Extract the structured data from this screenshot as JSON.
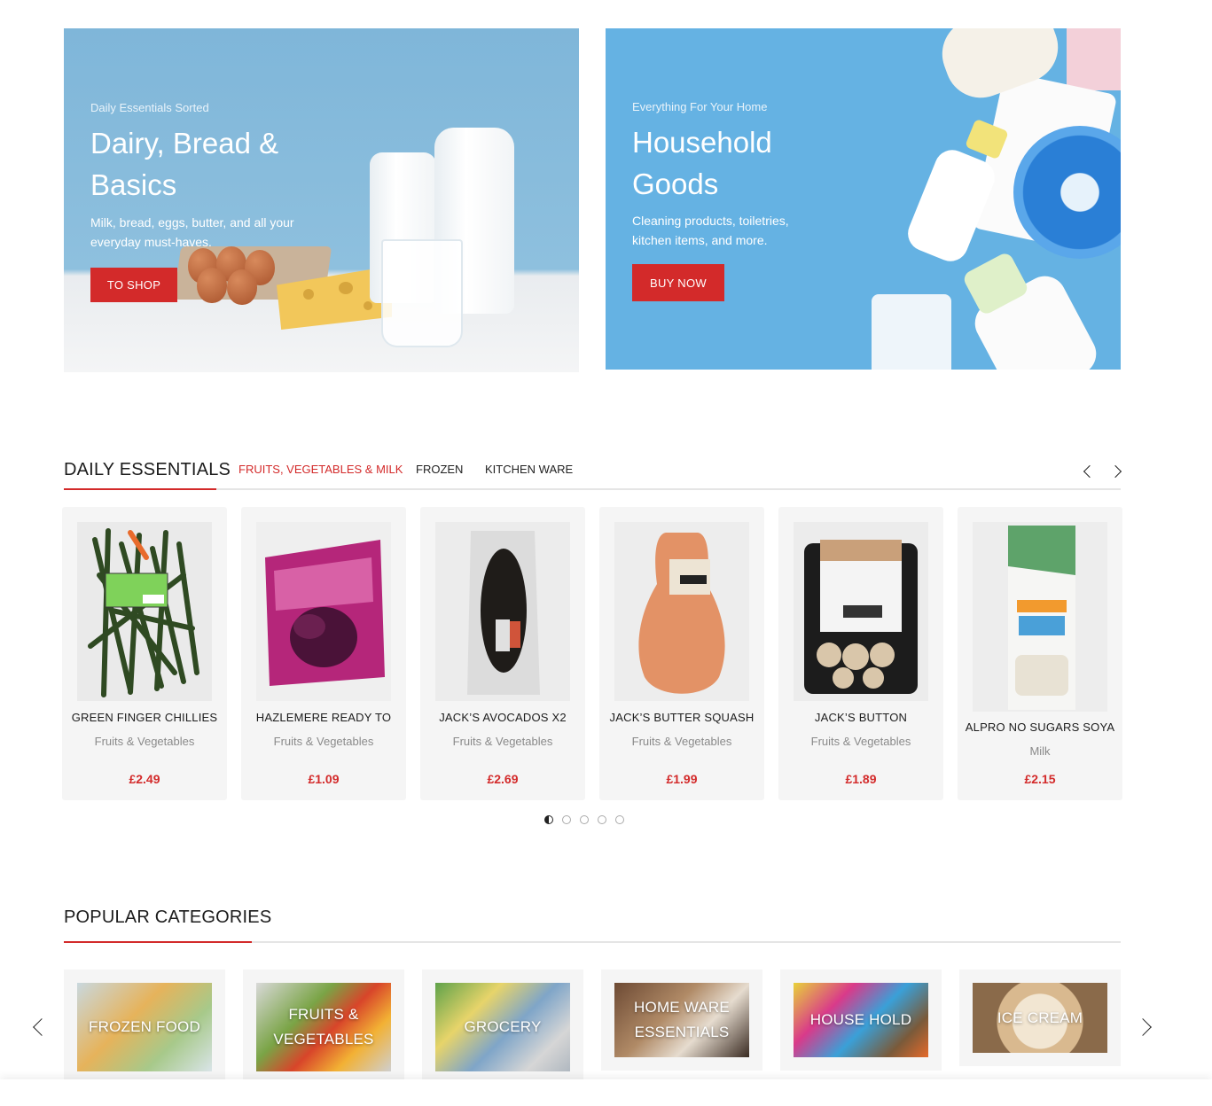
{
  "banners": [
    {
      "eyebrow": "Daily Essentials Sorted",
      "title_line1": "Dairy, Bread &",
      "title_line2": "Basics",
      "desc_line1": "Milk, bread, eggs, butter, and all your",
      "desc_line2": "everyday must-haves.",
      "button": "TO SHOP"
    },
    {
      "eyebrow": "Everything For Your Home",
      "title_line1": "Household",
      "title_line2": "Goods",
      "desc_line1": "Cleaning products, toiletries,",
      "desc_line2": "kitchen items, and more.",
      "button": "BUY NOW"
    }
  ],
  "daily_essentials": {
    "title": "DAILY ESSENTIALS",
    "tabs": [
      "FRUITS, VEGETABLES & MILK",
      "FROZEN",
      "KITCHEN WARE"
    ],
    "active_tab": 0,
    "products": [
      {
        "name": "GREEN FINGER CHILLIES",
        "category": "Fruits & Vegetables",
        "price": "£2.49",
        "image": "chillies-pack"
      },
      {
        "name": "HAZLEMERE READY TO",
        "category": "Fruits & Vegetables",
        "price": "£1.09",
        "image": "beetroot-pack"
      },
      {
        "name": "JACK’S AVOCADOS X2",
        "category": "Fruits & Vegetables",
        "price": "£2.69",
        "image": "avocado-pack"
      },
      {
        "name": "JACK’S BUTTER SQUASH",
        "category": "Fruits & Vegetables",
        "price": "£1.99",
        "image": "butternut-squash"
      },
      {
        "name": "JACK’S BUTTON",
        "category": "Fruits & Vegetables",
        "price": "£1.89",
        "image": "mushroom-pack"
      },
      {
        "name": "ALPRO NO SUGARS SOYA",
        "category": "Milk",
        "price": "£2.15",
        "image": "alpro-carton"
      }
    ],
    "pagination": {
      "pages": 5,
      "current": 1
    }
  },
  "popular_categories": {
    "title": "POPULAR CATEGORIES",
    "items": [
      {
        "line1": "FROZEN FOOD",
        "line2": ""
      },
      {
        "line1": "FRUITS &",
        "line2": "VEGETABLES"
      },
      {
        "line1": "GROCERY",
        "line2": ""
      },
      {
        "line1": "HOME WARE",
        "line2": "ESSENTIALS"
      },
      {
        "line1": "HOUSE HOLD",
        "line2": ""
      },
      {
        "line1": "ICE CREAM",
        "line2": ""
      }
    ]
  },
  "colors": {
    "accent": "#d32a2a",
    "card_bg": "#f5f5f5",
    "muted_text": "#8a8a8a"
  },
  "icons": [
    "chevron-left-icon",
    "chevron-right-icon"
  ]
}
